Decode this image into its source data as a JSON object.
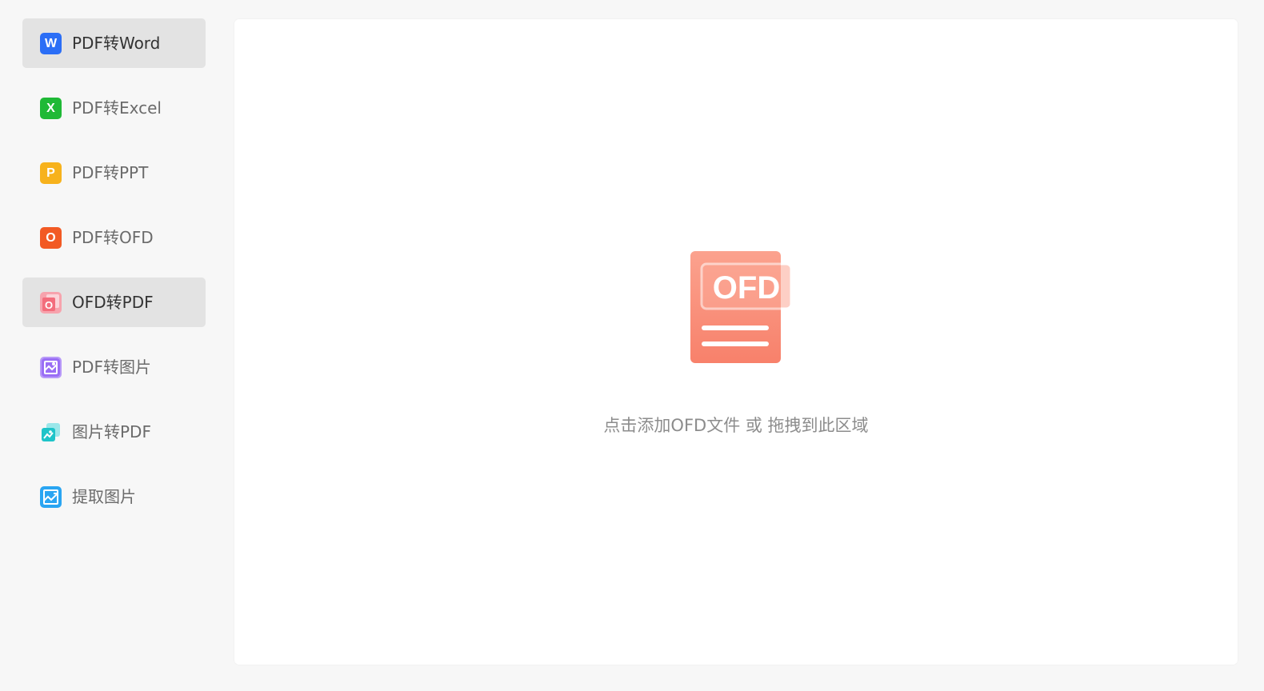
{
  "sidebar": {
    "items": [
      {
        "label": "PDF转Word",
        "icon": "word-icon",
        "icon_text": "W",
        "color": "#2b6ef6",
        "active": true
      },
      {
        "label": "PDF转Excel",
        "icon": "excel-icon",
        "icon_text": "X",
        "color": "#1fb936",
        "active": false
      },
      {
        "label": "PDF转PPT",
        "icon": "ppt-icon",
        "icon_text": "P",
        "color": "#f7b21c",
        "active": false
      },
      {
        "label": "PDF转OFD",
        "icon": "ofd-icon",
        "icon_text": "O",
        "color": "#f25a24",
        "active": false
      },
      {
        "label": "OFD转PDF",
        "icon": "ofd-to-pdf-icon",
        "icon_text": "O",
        "color": "#f36d7c",
        "active": true
      },
      {
        "label": "PDF转图片",
        "icon": "pdf-to-image-icon",
        "icon_text": "",
        "color": "#9a6ef5",
        "active": false
      },
      {
        "label": "图片转PDF",
        "icon": "image-to-pdf-icon",
        "icon_text": "",
        "color": "#1ec4c9",
        "active": false
      },
      {
        "label": "提取图片",
        "icon": "extract-image-icon",
        "icon_text": "",
        "color": "#2aa5f2",
        "active": false
      }
    ]
  },
  "main": {
    "illustration": {
      "icon": "ofd-file-icon",
      "badge_text": "OFD",
      "color": "#f8826d"
    },
    "drop_hint": "点击添加OFD文件 或 拖拽到此区域"
  }
}
